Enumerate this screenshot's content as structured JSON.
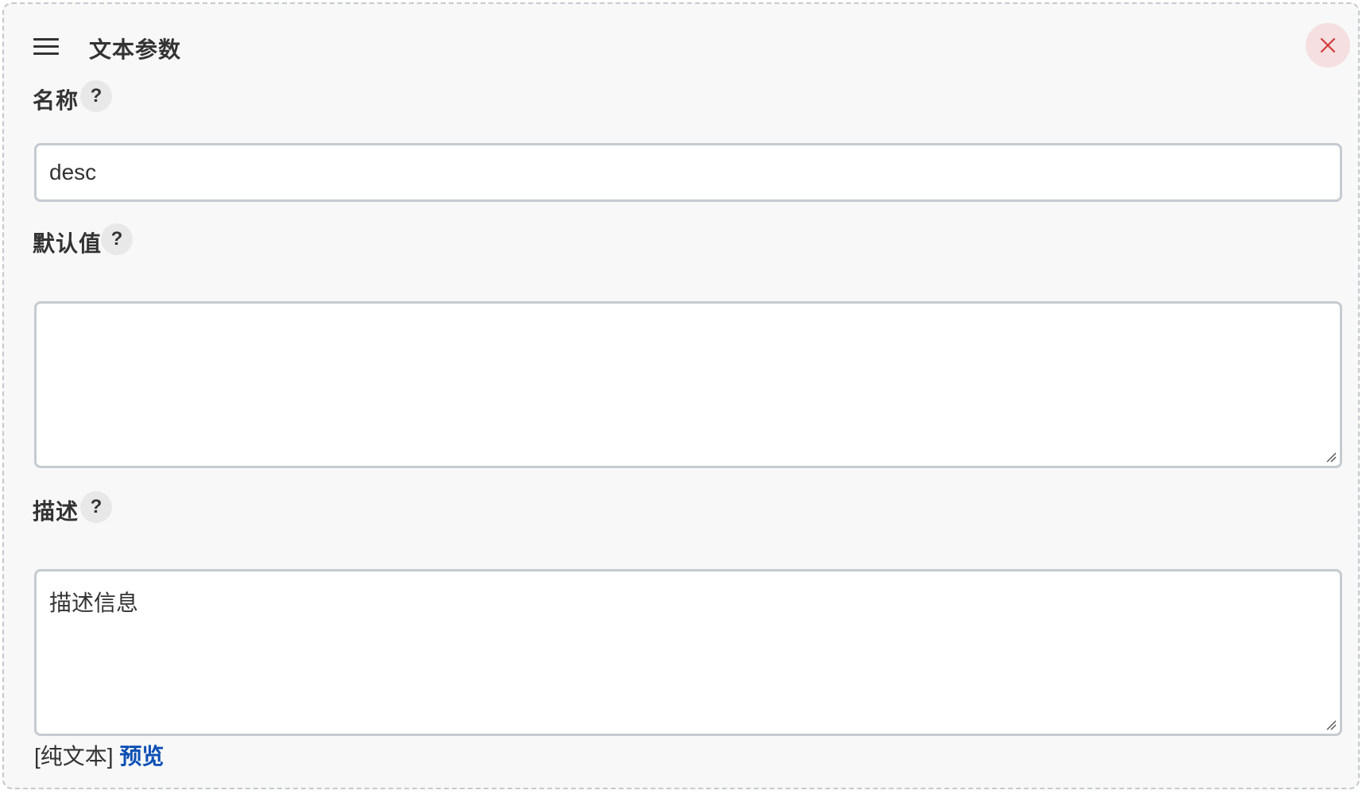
{
  "header": {
    "title": "文本参数",
    "drag_icon": "hamburger-menu-icon",
    "close_icon": "close-x-icon"
  },
  "fields": {
    "name": {
      "label": "名称",
      "help": "?",
      "value": "desc"
    },
    "default_value": {
      "label": "默认值",
      "help": "?",
      "value": ""
    },
    "description": {
      "label": "描述",
      "help": "?",
      "value": "描述信息"
    }
  },
  "footer": {
    "format": "[纯文本]",
    "preview": "预览"
  },
  "colors": {
    "close_icon": "#d23c3c",
    "close_bg": "#f5dfe0",
    "link": "#0b4fb5",
    "input_border": "#c4cbd1"
  }
}
